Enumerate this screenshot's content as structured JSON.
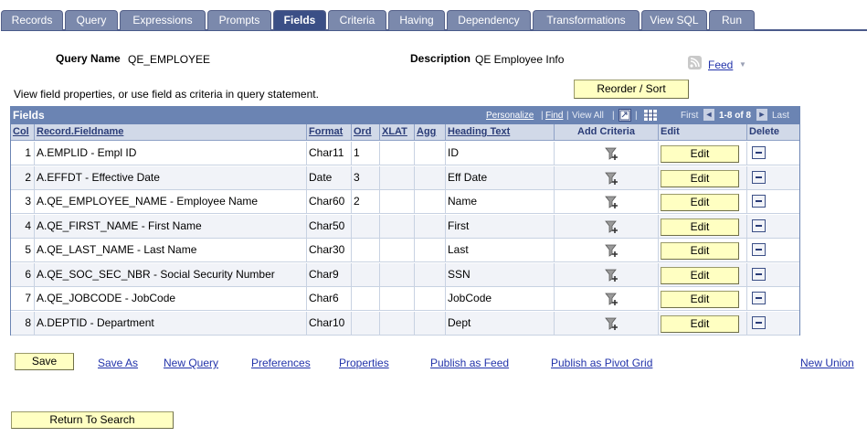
{
  "tabs": [
    {
      "label": "Records",
      "active": false
    },
    {
      "label": "Query",
      "active": false
    },
    {
      "label": "Expressions",
      "active": false
    },
    {
      "label": "Prompts",
      "active": false
    },
    {
      "label": "Fields",
      "active": true
    },
    {
      "label": "Criteria",
      "active": false
    },
    {
      "label": "Having",
      "active": false
    },
    {
      "label": "Dependency",
      "active": false
    },
    {
      "label": "Transformations",
      "active": false
    },
    {
      "label": "View SQL",
      "active": false
    },
    {
      "label": "Run",
      "active": false
    }
  ],
  "header": {
    "query_name_label": "Query Name",
    "query_name_value": "QE_EMPLOYEE",
    "description_label": "Description",
    "description_value": "QE Employee Info",
    "feed_label": "Feed",
    "feed_arrow": "▼"
  },
  "instructions": "View field properties, or use field as criteria in query statement.",
  "reorder_button": "Reorder / Sort",
  "grid": {
    "title": "Fields",
    "personalize": "Personalize",
    "find": "Find",
    "view_all": "View All",
    "sep": "|",
    "first": "First",
    "range": "1-8 of 8",
    "last": "Last",
    "prev_arrow": "◄",
    "next_arrow": "►",
    "columns": {
      "col": "Col",
      "record_fieldname": "Record.Fieldname",
      "format": "Format",
      "ord": "Ord",
      "xlat": "XLAT",
      "agg": "Agg",
      "heading_text": "Heading Text",
      "add_criteria": "Add Criteria",
      "edit": "Edit",
      "delete": "Delete"
    },
    "edit_label": "Edit",
    "rows": [
      {
        "col": "1",
        "field": "A.EMPLID - Empl ID",
        "format": "Char11",
        "ord": "1",
        "xlat": "",
        "agg": "",
        "heading": "ID"
      },
      {
        "col": "2",
        "field": "A.EFFDT - Effective Date",
        "format": "Date",
        "ord": "3",
        "xlat": "",
        "agg": "",
        "heading": "Eff Date"
      },
      {
        "col": "3",
        "field": "A.QE_EMPLOYEE_NAME - Employee Name",
        "format": "Char60",
        "ord": "2",
        "xlat": "",
        "agg": "",
        "heading": "Name"
      },
      {
        "col": "4",
        "field": "A.QE_FIRST_NAME - First Name",
        "format": "Char50",
        "ord": "",
        "xlat": "",
        "agg": "",
        "heading": "First"
      },
      {
        "col": "5",
        "field": "A.QE_LAST_NAME - Last Name",
        "format": "Char30",
        "ord": "",
        "xlat": "",
        "agg": "",
        "heading": "Last"
      },
      {
        "col": "6",
        "field": "A.QE_SOC_SEC_NBR - Social Security Number",
        "format": "Char9",
        "ord": "",
        "xlat": "",
        "agg": "",
        "heading": "SSN"
      },
      {
        "col": "7",
        "field": "A.QE_JOBCODE - JobCode",
        "format": "Char6",
        "ord": "",
        "xlat": "",
        "agg": "",
        "heading": "JobCode"
      },
      {
        "col": "8",
        "field": "A.DEPTID - Department",
        "format": "Char10",
        "ord": "",
        "xlat": "",
        "agg": "",
        "heading": "Dept"
      }
    ]
  },
  "footer": {
    "save": "Save",
    "save_as": "Save As",
    "new_query": "New Query",
    "preferences": "Preferences",
    "properties": "Properties",
    "publish_as_feed": "Publish as Feed",
    "publish_as_pivot_grid": "Publish as Pivot Grid",
    "new_union": "New Union",
    "return_to_search": "Return To Search"
  },
  "colors": {
    "tab": "#7b89ac",
    "tab_active": "#3b4f86",
    "grid_header": "#6b84b3",
    "button": "#ffffc2",
    "link": "#2233aa"
  }
}
